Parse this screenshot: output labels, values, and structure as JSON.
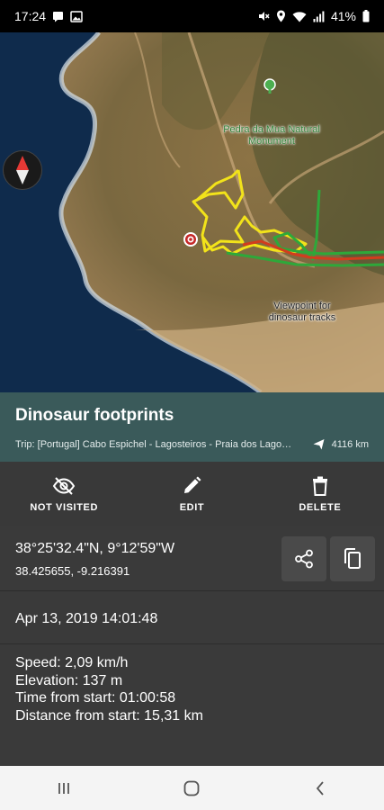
{
  "status_bar": {
    "time": "17:24",
    "battery": "41%",
    "left_icons": [
      "message-icon",
      "gallery-icon"
    ],
    "right_icons": [
      "mute-icon",
      "location-icon",
      "wifi-icon",
      "signal-icon",
      "battery-icon"
    ]
  },
  "map": {
    "poi_label": "Pedra da Mua Natural Monument",
    "viewpoint_label": "Viewpoint for dinosaur tracks",
    "compass_icon": "compass-icon",
    "colors": {
      "sea": "#0f2b4c",
      "track_yellow": "#f2e31a",
      "track_green": "#2ea83a",
      "track_red": "#d23d1d"
    }
  },
  "header": {
    "title": "Dinosaur footprints",
    "trip": "Trip: [Portugal] Cabo Espichel - Lagosteiros - Praia dos Lagosteiros",
    "distance": "4116 km",
    "background": "#3a5a5a"
  },
  "actions": {
    "not_visited": "NOT VISITED",
    "edit": "EDIT",
    "delete": "DELETE"
  },
  "coords": {
    "dms": "38°25'32.4\"N, 9°12'59\"W",
    "decimal": "38.425655, -9.216391"
  },
  "date": "Apr 13, 2019 14:01:48",
  "stats": {
    "speed": "Speed: 2,09 km/h",
    "elevation": "Elevation: 137 m",
    "time_from_start": "Time from start: 01:00:58",
    "distance_from_start": "Distance from start: 15,31 km"
  }
}
